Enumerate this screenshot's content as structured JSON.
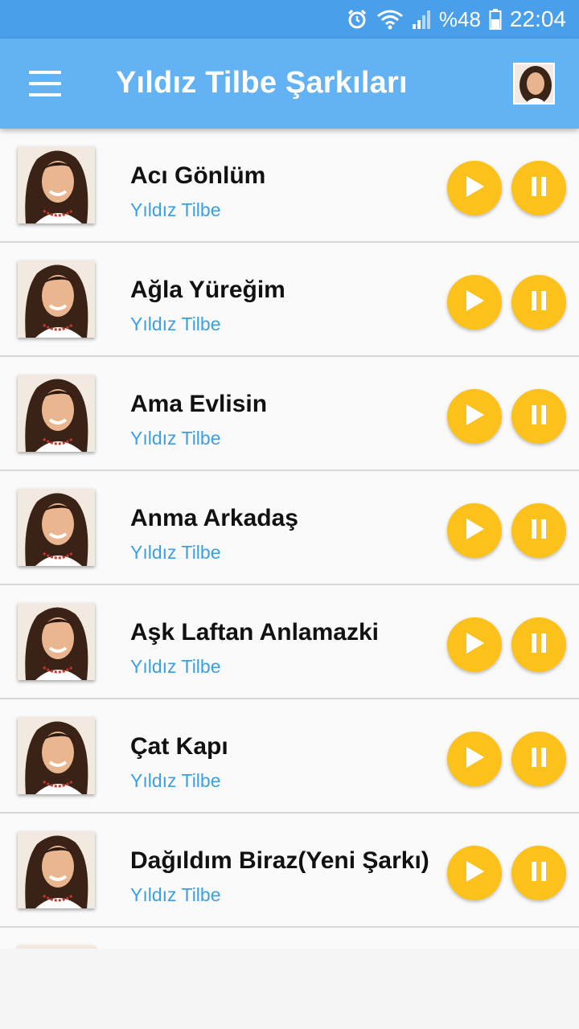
{
  "status_bar": {
    "battery_text": "%48",
    "time": "22:04",
    "icons": [
      "alarm-icon",
      "wifi-icon",
      "signal-icon",
      "battery-icon"
    ]
  },
  "app_bar": {
    "title": "Yıldız Tilbe Şarkıları",
    "menu_icon": "hamburger-menu-icon",
    "avatar_icon": "artist-avatar"
  },
  "songs": [
    {
      "title": "Acı Gönlüm",
      "artist": "Yıldız Tilbe"
    },
    {
      "title": "Ağla Yüreğim",
      "artist": "Yıldız Tilbe"
    },
    {
      "title": "Ama Evlisin",
      "artist": "Yıldız Tilbe"
    },
    {
      "title": "Anma Arkadaş",
      "artist": "Yıldız Tilbe"
    },
    {
      "title": "Aşk Laftan Anlamazki",
      "artist": "Yıldız Tilbe"
    },
    {
      "title": "Çat Kapı",
      "artist": "Yıldız Tilbe"
    },
    {
      "title": "Dağıldım Biraz(Yeni Şarkı)",
      "artist": "Yıldız Tilbe"
    }
  ],
  "colors": {
    "status_bar": "#4a9fea",
    "app_bar": "#63b2f4",
    "button": "#fcc21b",
    "artist_text": "#3ba0e3"
  }
}
